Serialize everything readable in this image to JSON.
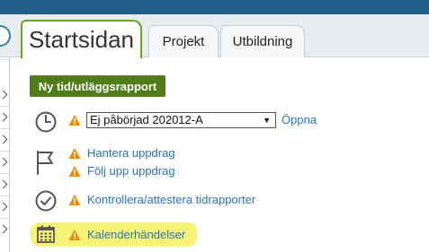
{
  "tabs": [
    {
      "label": "Startsidan",
      "active": true
    },
    {
      "label": "Projekt",
      "active": false
    },
    {
      "label": "Utbildning",
      "active": false
    }
  ],
  "actions": {
    "new_report_label": "Ny tid/utläggsrapport"
  },
  "tasks": {
    "report_select": {
      "selected": "Ej påbörjad 202012-A"
    },
    "open_link": "Öppna",
    "assignments": [
      {
        "label": "Hantera uppdrag"
      },
      {
        "label": "Följ upp uppdrag"
      }
    ],
    "approve_label": "Kontrollera/attestera tidrapporter",
    "calendar_label": "Kalenderhändelser"
  },
  "colors": {
    "accent_green": "#4f7d18",
    "link_blue": "#2a73b8",
    "warning_orange": "#f08a00",
    "highlight_yellow": "#f4f36a"
  },
  "icons": {
    "clock": "clock-icon",
    "flag": "flag-icon",
    "check": "check-circle-icon",
    "calendar": "calendar-icon",
    "warning": "warning-icon"
  }
}
